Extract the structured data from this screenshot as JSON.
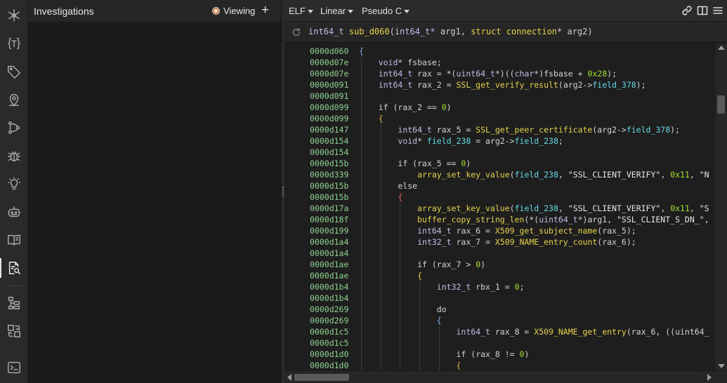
{
  "sidebar": {
    "icons": [
      {
        "name": "graph-icon"
      },
      {
        "name": "types-icon"
      },
      {
        "name": "tags-icon"
      },
      {
        "name": "location-icon"
      },
      {
        "name": "git-branch-icon"
      },
      {
        "name": "bug-icon"
      },
      {
        "name": "lightbulb-icon"
      },
      {
        "name": "robot-icon"
      },
      {
        "name": "book-icon"
      },
      {
        "name": "investigation-icon",
        "active": true
      },
      {
        "name": "hierarchy-icon"
      },
      {
        "name": "compare-icon"
      },
      {
        "name": "terminal-icon"
      }
    ]
  },
  "investigations": {
    "title": "Investigations",
    "viewing_label": "Viewing",
    "add_label": "+"
  },
  "toolbar": {
    "view_type": "ELF",
    "layout": "Linear",
    "language": "Pseudo C",
    "icons": [
      "link-icon",
      "split-view-icon",
      "menu-icon"
    ]
  },
  "signature": "int64_t sub_d060(int64_t* arg1, struct connection* arg2)",
  "code_lines": [
    {
      "addr": "0000d060",
      "text": "{"
    },
    {
      "addr": "0000d07e",
      "text": "    void* fsbase;"
    },
    {
      "addr": "0000d07e",
      "text": "    int64_t rax = *(uint64_t*)((char*)fsbase + 0x28);"
    },
    {
      "addr": "0000d091",
      "text": "    int64_t rax_2 = SSL_get_verify_result(arg2->field_378);"
    },
    {
      "addr": "0000d091",
      "text": ""
    },
    {
      "addr": "0000d099",
      "text": "    if (rax_2 == 0)"
    },
    {
      "addr": "0000d099",
      "text": "    {"
    },
    {
      "addr": "0000d147",
      "text": "        int64_t rax_5 = SSL_get_peer_certificate(arg2->field_378);"
    },
    {
      "addr": "0000d154",
      "text": "        void* field_238 = arg2->field_238;"
    },
    {
      "addr": "0000d154",
      "text": ""
    },
    {
      "addr": "0000d15b",
      "text": "        if (rax_5 == 0)"
    },
    {
      "addr": "0000d339",
      "text": "            array_set_key_value(field_238, \"SSL_CLIENT_VERIFY\", 0x11, \"N"
    },
    {
      "addr": "0000d15b",
      "text": "        else"
    },
    {
      "addr": "0000d15b",
      "text": "        {"
    },
    {
      "addr": "0000d17a",
      "text": "            array_set_key_value(field_238, \"SSL_CLIENT_VERIFY\", 0x11, \"S"
    },
    {
      "addr": "0000d18f",
      "text": "            buffer_copy_string_len(*(uint64_t*)arg1, \"SSL_CLIENT_S_DN_\","
    },
    {
      "addr": "0000d199",
      "text": "            int64_t rax_6 = X509_get_subject_name(rax_5);"
    },
    {
      "addr": "0000d1a4",
      "text": "            int32_t rax_7 = X509_NAME_entry_count(rax_6);"
    },
    {
      "addr": "0000d1a4",
      "text": ""
    },
    {
      "addr": "0000d1ae",
      "text": "            if (rax_7 > 0)"
    },
    {
      "addr": "0000d1ae",
      "text": "            {"
    },
    {
      "addr": "0000d1b4",
      "text": "                int32_t rbx_1 = 0;"
    },
    {
      "addr": "0000d1b4",
      "text": ""
    },
    {
      "addr": "0000d269",
      "text": "                do"
    },
    {
      "addr": "0000d269",
      "text": "                {"
    },
    {
      "addr": "0000d1c5",
      "text": "                    int64_t rax_8 = X509_NAME_get_entry(rax_6, ((uint64_"
    },
    {
      "addr": "0000d1c5",
      "text": ""
    },
    {
      "addr": "0000d1d0",
      "text": "                    if (rax_8 != 0)"
    },
    {
      "addr": "0000d1d0",
      "text": "                    {"
    }
  ],
  "colors": {
    "address": "#8fd18f",
    "function": "#e6d24d",
    "field": "#64d8e6",
    "number": "#a6e22e",
    "type": "#c8b9e6"
  }
}
